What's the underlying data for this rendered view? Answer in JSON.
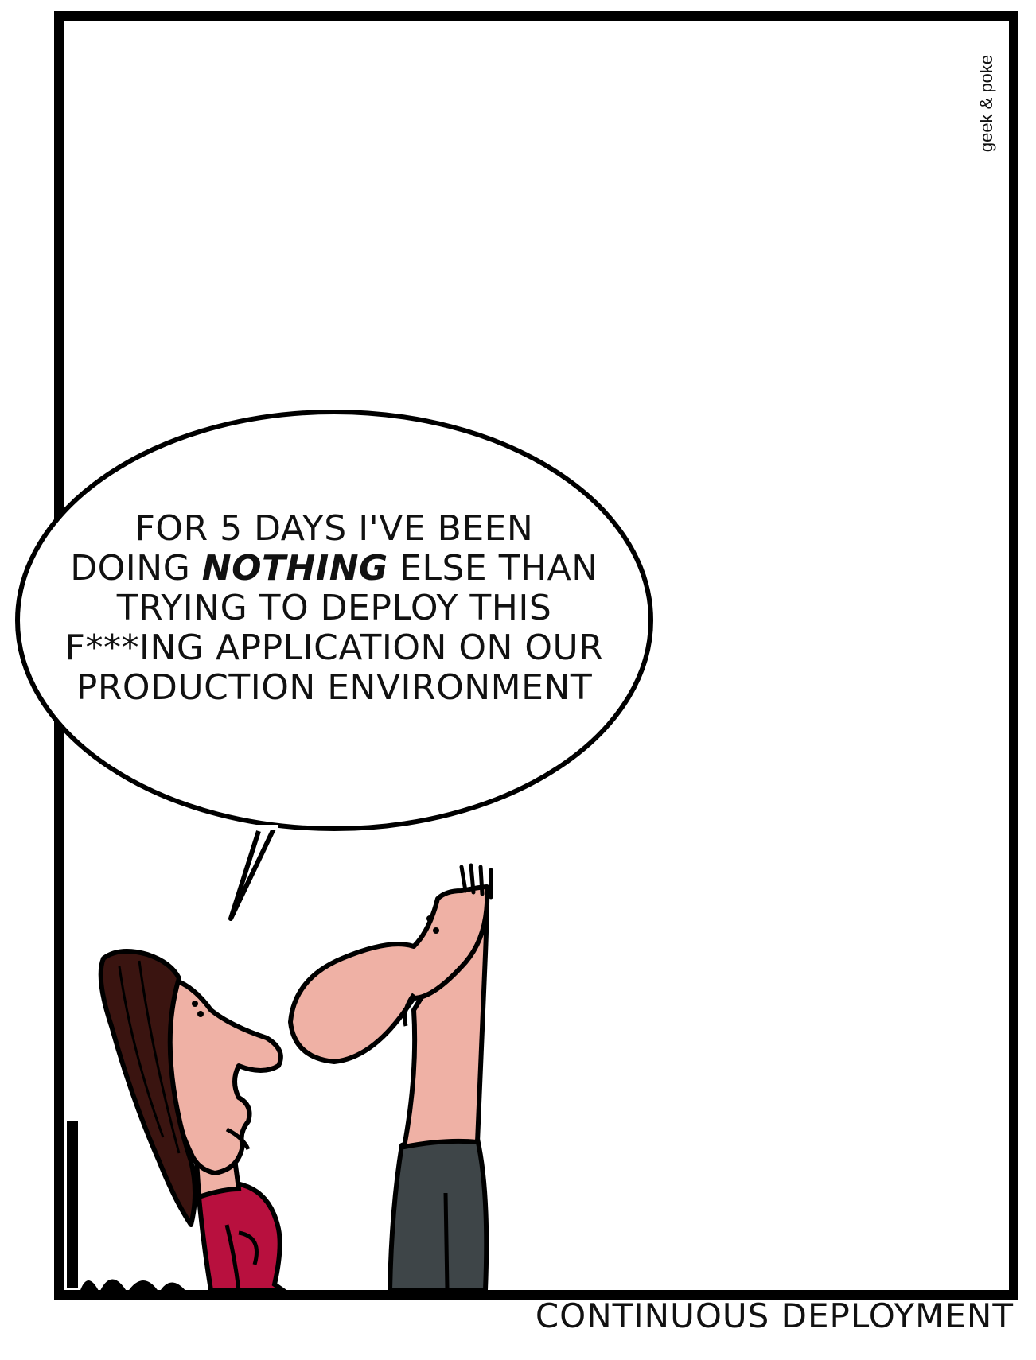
{
  "speech_bubble": {
    "line1": "FOR 5 DAYS I'VE BEEN",
    "line2_before": "DOING ",
    "line2_emphasis": "NOTHING",
    "line2_after": " ELSE THAN",
    "line3": "TRYING TO DEPLOY THIS",
    "line4": "F***ING APPLICATION ON OUR",
    "line5": "PRODUCTION ENVIRONMENT"
  },
  "credit": "geek & poke",
  "caption": "CONTINUOUS DEPLOYMENT",
  "colors": {
    "outline": "#000000",
    "panel_background": "#ffffff",
    "skin": "#efb1a5",
    "hair": "#3a1410",
    "shirt": "#b8103e",
    "pants": "#3e4548"
  }
}
